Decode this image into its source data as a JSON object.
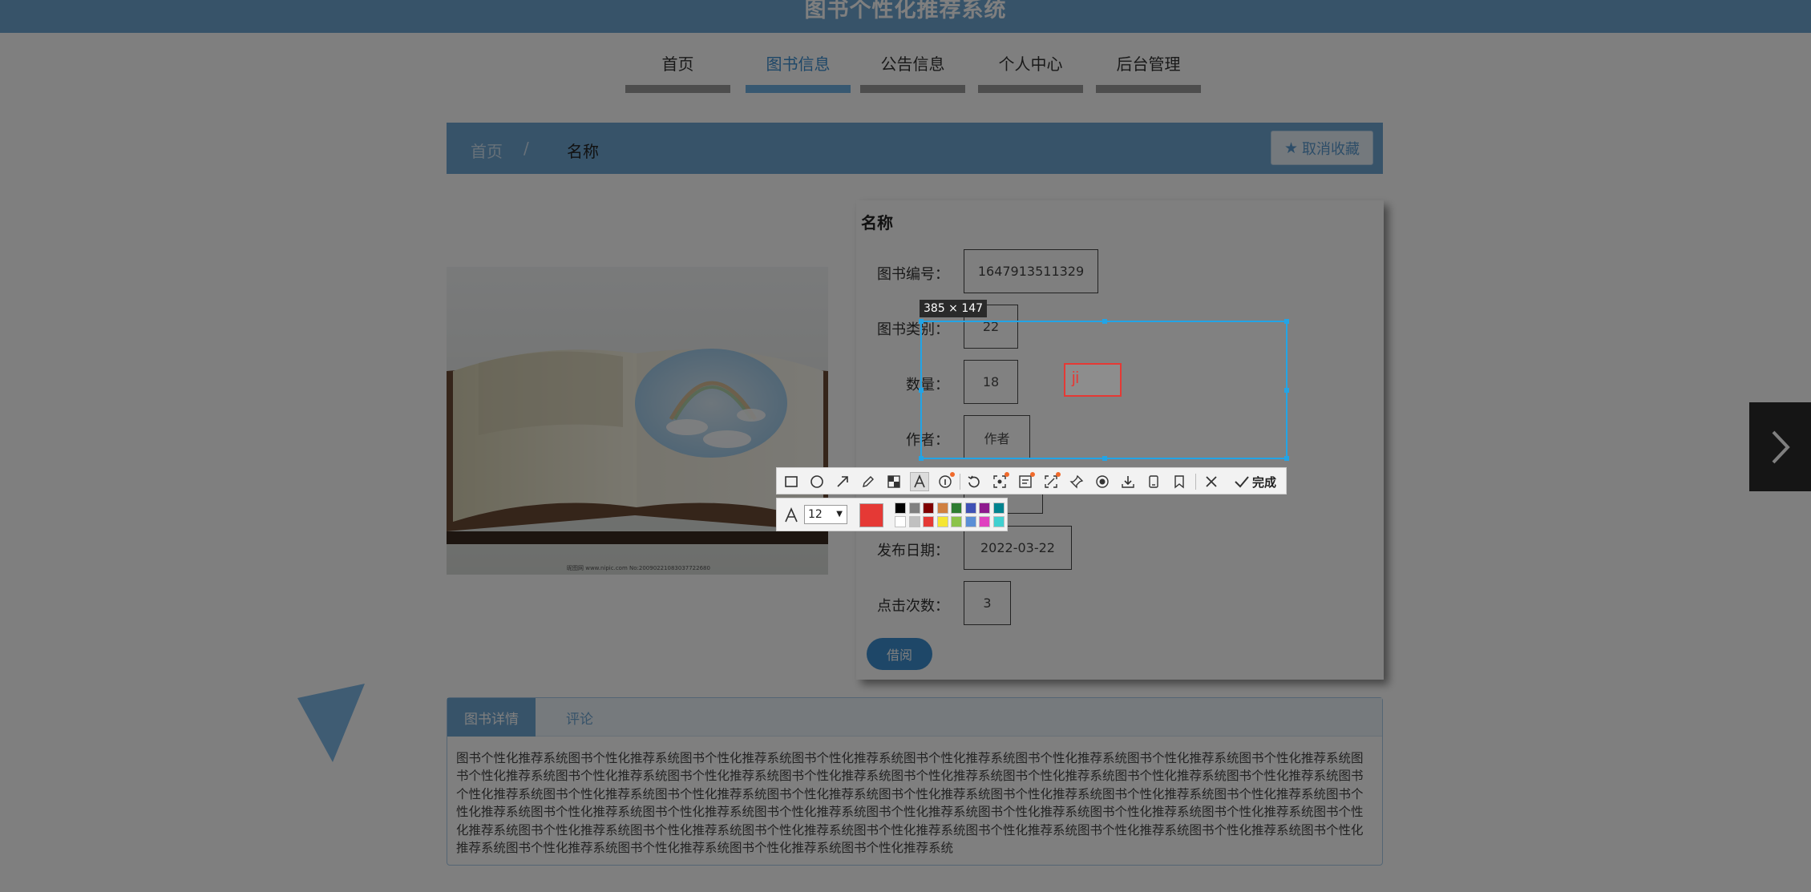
{
  "header": {
    "title": "图书个性化推荐系统"
  },
  "nav": {
    "items": [
      {
        "label": "首页"
      },
      {
        "label": "图书信息"
      },
      {
        "label": "公告信息"
      },
      {
        "label": "个人中心"
      },
      {
        "label": "后台管理"
      }
    ],
    "active_label": "图书信息"
  },
  "breadcrumb": {
    "home": "首页",
    "separator": "/",
    "current": "名称"
  },
  "favorite": {
    "label": "取消收藏",
    "icon": "star-icon"
  },
  "book": {
    "title": "名称",
    "image_caption": "昵图网 www.nipic.com  No:20090221083037722680",
    "fields": [
      {
        "label": "图书编号：",
        "value": "1647913511329"
      },
      {
        "label": "图书类别：",
        "value": "22"
      },
      {
        "label": "数量：",
        "value": "18"
      },
      {
        "label": "作者：",
        "value": "作者"
      },
      {
        "label": "发布日期：",
        "value": "2022-03-22"
      },
      {
        "label": "点击次数：",
        "value": "3"
      }
    ],
    "borrow_label": "借阅"
  },
  "tabs": {
    "details_label": "图书详情",
    "comments_label": "评论",
    "description": "图书个性化推荐系统图书个性化推荐系统图书个性化推荐系统图书个性化推荐系统图书个性化推荐系统图书个性化推荐系统图书个性化推荐系统图书个性化推荐系统图书个性化推荐系统图书个性化推荐系统图书个性化推荐系统图书个性化推荐系统图书个性化推荐系统图书个性化推荐系统图书个性化推荐系统图书个性化推荐系统图书个性化推荐系统图书个性化推荐系统图书个性化推荐系统图书个性化推荐系统图书个性化推荐系统图书个性化推荐系统图书个性化推荐系统图书个性化推荐系统图书个性化推荐系统图书个性化推荐系统图书个性化推荐系统图书个性化推荐系统图书个性化推荐系统图书个性化推荐系统图书个性化推荐系统图书个性化推荐系统图书个性化推荐系统图书个性化推荐系统图书个性化推荐系统图书个性化推荐系统图书个性化推荐系统图书个性化推荐系统图书个性化推荐系统图书个性化推荐系统图书个性化推荐系统图书个性化推荐系统图书个性化推荐系统图书个性化推荐系统图书个性化推荐系统"
  },
  "screenshot_tool": {
    "size_label": "385 × 147",
    "annotation_text": "ji",
    "done_label": "完成",
    "font_size": "12",
    "current_color": "#e53935",
    "tools": [
      "rectangle-icon",
      "ellipse-icon",
      "arrow-icon",
      "pencil-icon",
      "mosaic-icon",
      "text-icon",
      "serial-number-icon",
      "undo-icon",
      "screen-record-icon",
      "ocr-icon",
      "long-screenshot-icon",
      "pin-icon",
      "record-icon",
      "download-icon",
      "save-icon",
      "bookmark-icon",
      "close-icon",
      "check-icon"
    ],
    "palette_top": [
      "#000000",
      "#808080",
      "#800000",
      "#d08040",
      "#2e7d32",
      "#3f51b5",
      "#8e1a8e",
      "#00838f"
    ],
    "palette_bottom": [
      "#ffffff",
      "#c0c0c0",
      "#e53935",
      "#f5e633",
      "#8bc34a",
      "#5b8fd6",
      "#e040c0",
      "#40d0d0"
    ]
  },
  "colors": {
    "accent": "#6fa6d3",
    "link_active": "#3d8fd0",
    "selection": "#22a4e6"
  }
}
